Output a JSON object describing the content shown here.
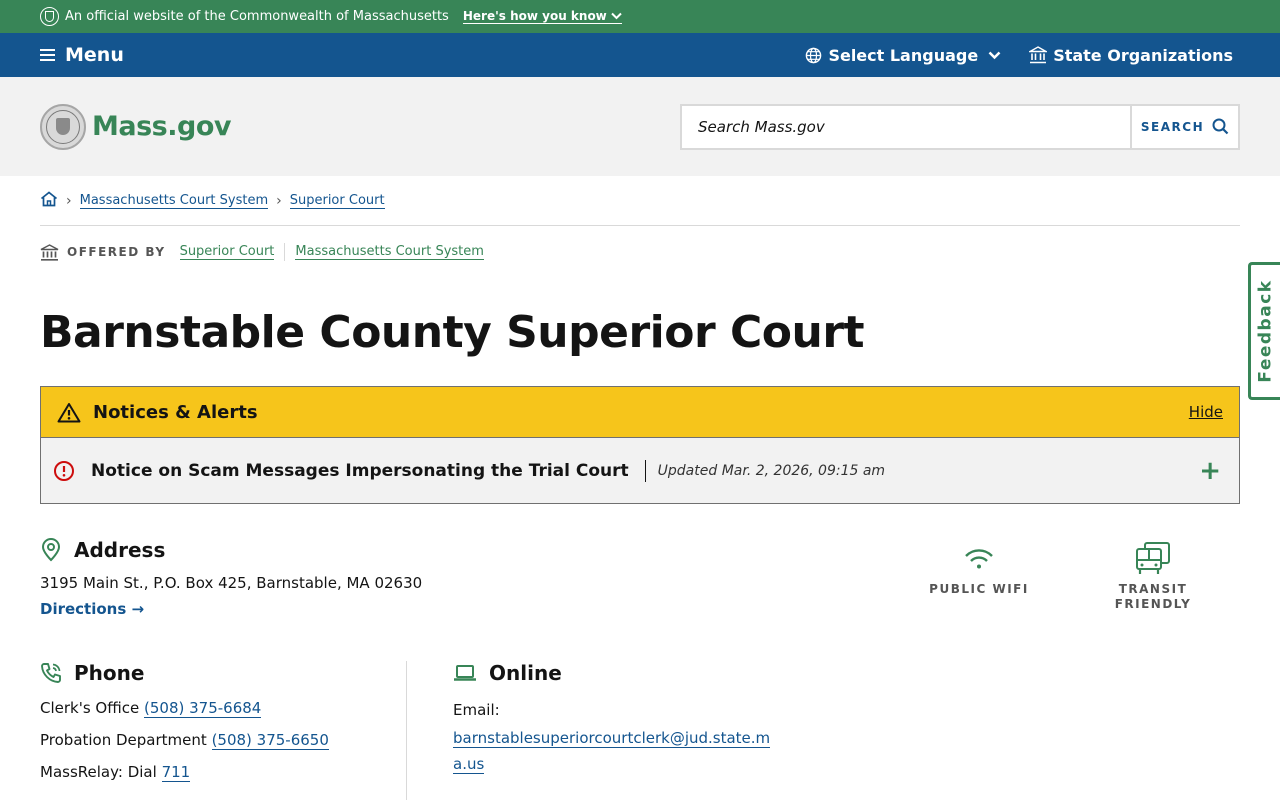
{
  "official_bar": {
    "text": "An official website of the Commonwealth of Massachusetts",
    "link": "Here's how you know"
  },
  "nav": {
    "menu_label": "Menu",
    "language_label": "Select Language",
    "orgs_label": "State Organizations"
  },
  "header": {
    "logo_text": "Mass.gov",
    "search_placeholder": "Search Mass.gov",
    "search_button": "SEARCH"
  },
  "breadcrumb": {
    "items": [
      "Massachusetts Court System",
      "Superior Court"
    ]
  },
  "offered_by": {
    "label": "OFFERED BY",
    "orgs": [
      "Superior Court",
      "Massachusetts Court System"
    ]
  },
  "page_title": "Barnstable County Superior Court",
  "alerts": {
    "title": "Notices & Alerts",
    "hide_label": "Hide",
    "items": [
      {
        "title": "Notice on Scam Messages Impersonating the Trial Court",
        "updated": "Updated Mar. 2, 2026, 09:15 am"
      }
    ]
  },
  "address": {
    "title": "Address",
    "text": "3195 Main St., P.O. Box 425, Barnstable, MA 02630",
    "directions_label": "Directions →"
  },
  "amenities": [
    {
      "label": "PUBLIC WIFI"
    },
    {
      "label": "TRANSIT FRIENDLY"
    }
  ],
  "phone": {
    "title": "Phone",
    "entries": [
      {
        "label": "Clerk's Office",
        "number": "(508) 375-6684"
      },
      {
        "label": "Probation Department",
        "number": "(508) 375-6650"
      },
      {
        "label": "MassRelay: Dial",
        "number": "711"
      }
    ]
  },
  "online": {
    "title": "Online",
    "email_label": "Email:",
    "email": "barnstablesuperiorcourtclerk@jud.state.ma.us"
  },
  "feedback_label": "Feedback",
  "colors": {
    "green": "#388557",
    "blue": "#14558f",
    "alert_yellow": "#f6c51b",
    "danger_red": "#cd0d0d"
  }
}
